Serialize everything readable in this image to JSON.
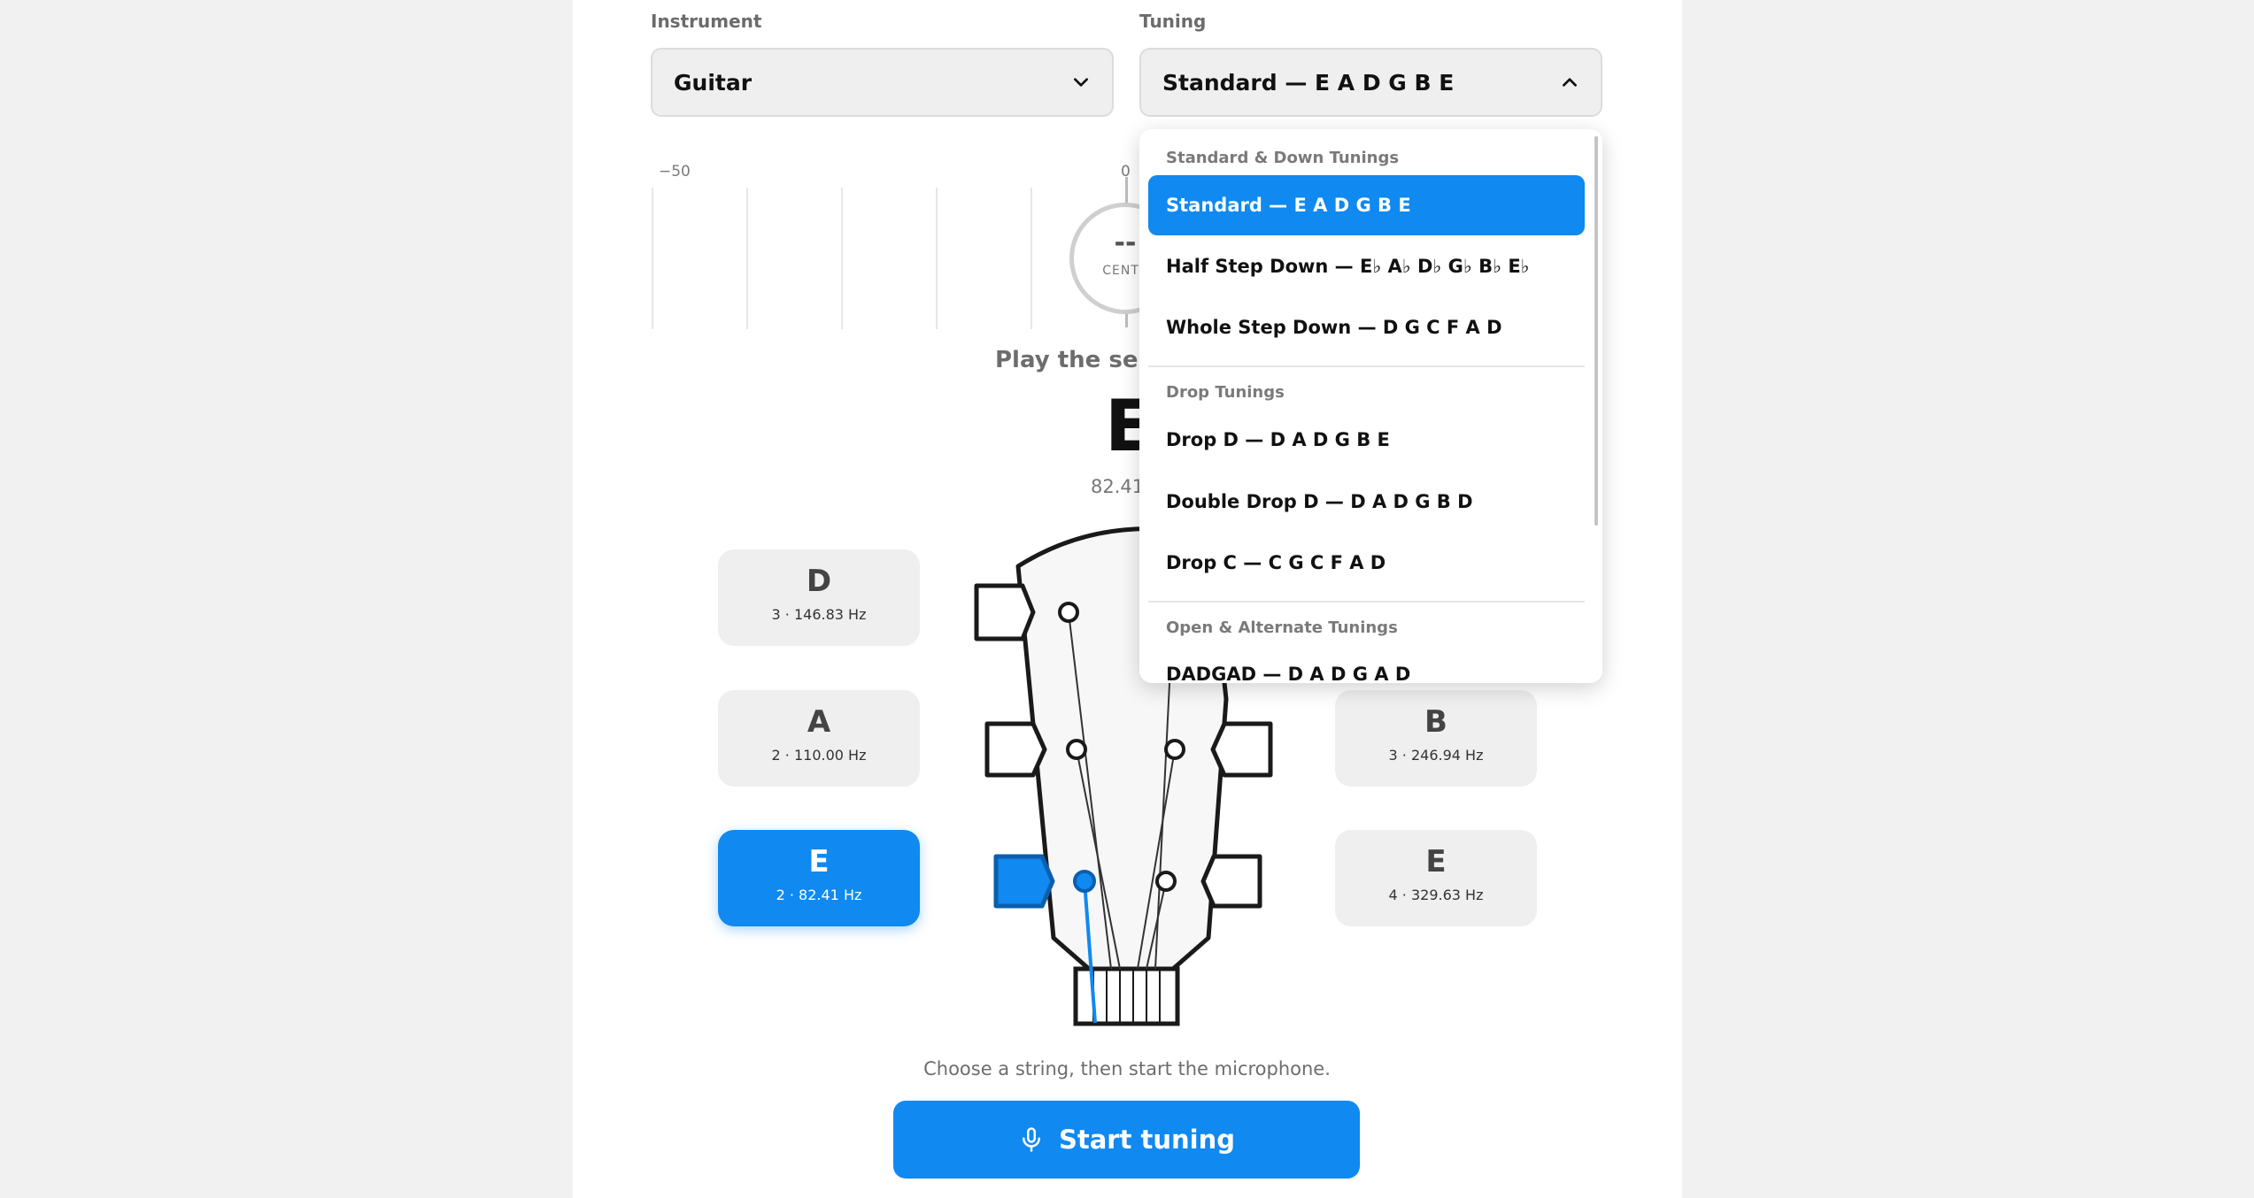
{
  "instrument": {
    "label": "Instrument",
    "value": "Guitar"
  },
  "tuning": {
    "label": "Tuning",
    "value": "Standard — E A D G B E"
  },
  "meter": {
    "left_label": "−50",
    "center_label": "0",
    "cents_value": "--",
    "cents_unit": "CENTS"
  },
  "prompt": "Play the selected string",
  "current": {
    "note": "E",
    "freq": "82.41 Hz"
  },
  "strings": {
    "d3": {
      "note": "D",
      "freq": "3 · 146.83 Hz"
    },
    "a2": {
      "note": "A",
      "freq": "2 · 110.00 Hz"
    },
    "e2": {
      "note": "E",
      "freq": "2 · 82.41 Hz"
    },
    "b3": {
      "note": "B",
      "freq": "3 · 246.94 Hz"
    },
    "e4": {
      "note": "E",
      "freq": "4 · 329.63 Hz"
    }
  },
  "hint": "Choose a string, then start the microphone.",
  "start_label": "Start tuning",
  "dropdown": {
    "groups": [
      {
        "label": "Standard & Down Tunings",
        "options": [
          "Standard — E A D G B E",
          "Half Step Down — E♭ A♭ D♭ G♭ B♭ E♭",
          "Whole Step Down — D G C F A D"
        ]
      },
      {
        "label": "Drop Tunings",
        "options": [
          "Drop D — D A D G B E",
          "Double Drop D — D A D G B D",
          "Drop C — C G C F A D"
        ]
      },
      {
        "label": "Open & Alternate Tunings",
        "options": [
          "DADGAD — D A D G A D"
        ]
      }
    ]
  },
  "colors": {
    "accent": "#1089f0",
    "panel": "#ffffff",
    "background": "#f1f1f1"
  }
}
